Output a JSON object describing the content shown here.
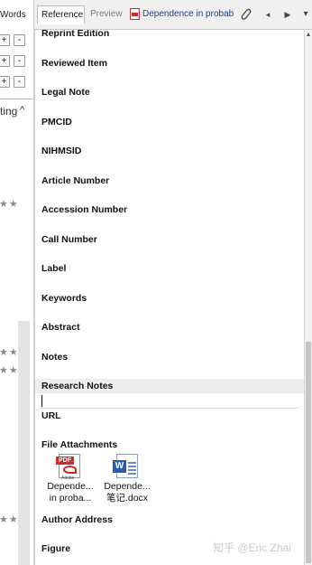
{
  "left_panel": {
    "words_label": "Words",
    "plus_label": "+",
    "minus_label": "-",
    "sort_label": "ting",
    "sort_caret": "^",
    "star_glyph": "★★"
  },
  "tabs": {
    "reference": "Reference",
    "preview": "Preview",
    "pdf_title": "Dependence in probab"
  },
  "toolbar": {
    "attach_icon": "paperclip-icon",
    "prev_glyph": "◂",
    "next_glyph": "▶",
    "menu_glyph": "▾"
  },
  "reference_fields": [
    "Reprint Edition",
    "Reviewed Item",
    "Legal Note",
    "PMCID",
    "NIHMSID",
    "Article Number",
    "Accession Number",
    "Call Number",
    "Label",
    "Keywords",
    "Abstract",
    "Notes",
    "Research Notes",
    "URL",
    "File Attachments",
    "Author Address",
    "Figure"
  ],
  "attachments": [
    {
      "line1": "Depende...",
      "line2": "in proba...",
      "icon": "pdf-file-icon"
    },
    {
      "line1": "Depende...",
      "line2": "笔记.docx",
      "icon": "word-file-icon"
    }
  ],
  "watermark": "知乎 @Eric Zhai",
  "colors": {
    "tab_bar_bg": "#f0f0f0",
    "highlight_row": "#eeeeee",
    "pdf_red": "#d12a2a",
    "word_blue": "#2b5caa"
  }
}
